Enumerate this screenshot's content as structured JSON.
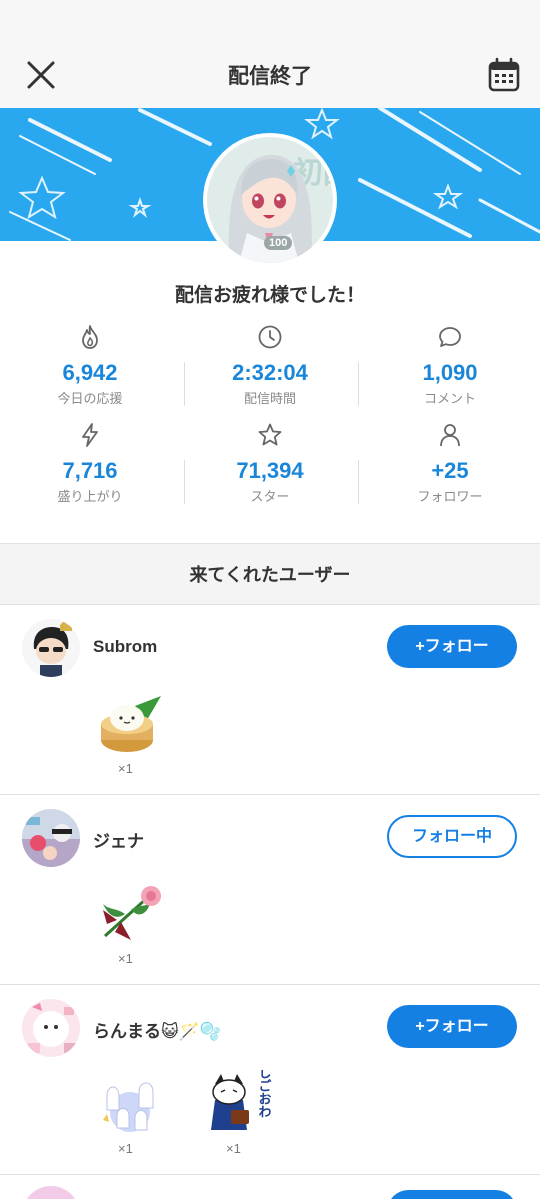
{
  "header": {
    "title": "配信終了",
    "close_icon": "close-icon",
    "calendar_icon": "calendar-icon"
  },
  "banner": {
    "level_badge": "100",
    "avatar_text": "初配信"
  },
  "thanks_message": "配信お疲れ様でした！",
  "stats": [
    {
      "icon": "flame-icon",
      "value": "6,942",
      "label": "今日の応援"
    },
    {
      "icon": "clock-icon",
      "value": "2:32:04",
      "label": "配信時間"
    },
    {
      "icon": "comment-icon",
      "value": "1,090",
      "label": "コメント"
    },
    {
      "icon": "lightning-icon",
      "value": "7,716",
      "label": "盛り上がり"
    },
    {
      "icon": "star-icon",
      "value": "71,394",
      "label": "スター"
    },
    {
      "icon": "person-icon",
      "value": "+25",
      "label": "フォロワー"
    }
  ],
  "visitors_section": {
    "title": "来てくれたユーザー"
  },
  "users": [
    {
      "name": "Subrom",
      "button": "+フォロー",
      "following": false,
      "gifts": [
        {
          "icon": "dumpling-steamer-gift-icon",
          "count": "×1"
        }
      ]
    },
    {
      "name": "ジェナ",
      "button": "フォロー中",
      "following": true,
      "gifts": [
        {
          "icon": "rose-ribbon-gift-icon",
          "count": "×1"
        }
      ]
    },
    {
      "name": "らんまる😺🪄🫧",
      "button": "+フォロー",
      "following": false,
      "gifts": [
        {
          "icon": "ghost-family-gift-icon",
          "count": "×1"
        },
        {
          "icon": "cat-salaryman-gift-icon",
          "count": "×1"
        }
      ],
      "gift_caption": "しごおわ"
    }
  ],
  "colors": {
    "accent": "#1580e3",
    "stat_value": "#1a86d9",
    "banner": "#2aa8ef"
  }
}
